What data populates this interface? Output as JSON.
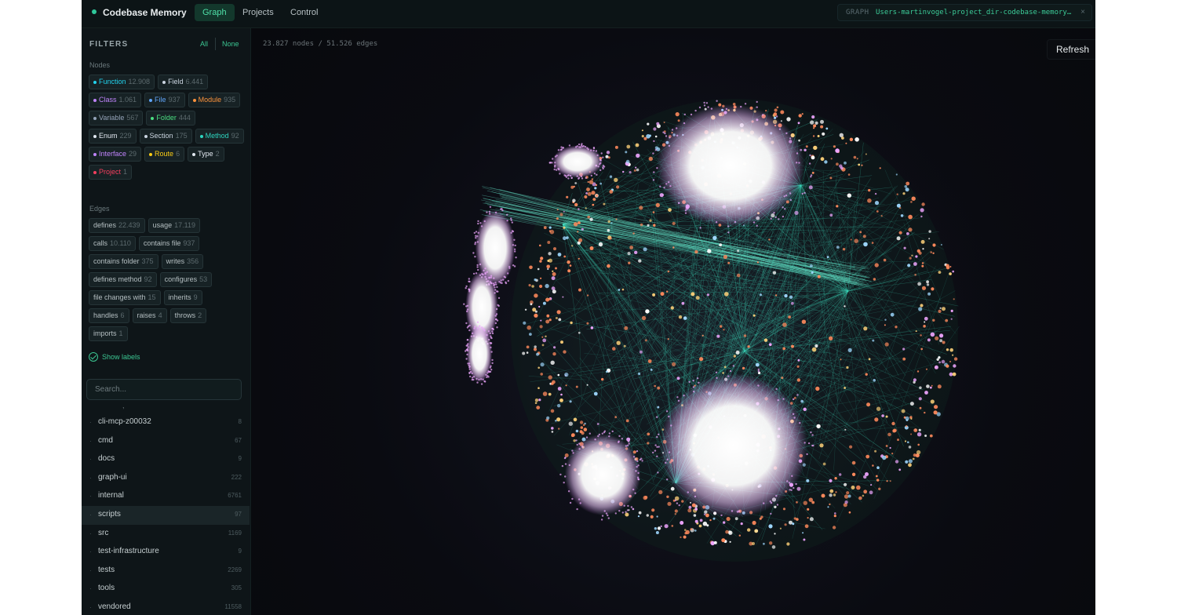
{
  "app": {
    "brand": "Codebase Memory",
    "tabs": [
      {
        "label": "Graph",
        "active": true
      },
      {
        "label": "Projects",
        "active": false
      },
      {
        "label": "Control",
        "active": false
      }
    ],
    "graph_pill": {
      "label": "GRAPH",
      "value": "Users-martinvogel-project_dir-codebase-memory-mcp",
      "close": "×"
    }
  },
  "filters": {
    "title": "FILTERS",
    "all": "All",
    "none": "None",
    "nodes_label": "Nodes",
    "edges_label": "Edges",
    "nodes": [
      {
        "name": "Function",
        "count": "12.908",
        "color": "#22d3ee"
      },
      {
        "name": "Field",
        "count": "6.441",
        "color": "#cbd5e1"
      },
      {
        "name": "Class",
        "count": "1.061",
        "color": "#c084fc"
      },
      {
        "name": "File",
        "count": "937",
        "color": "#60a5fa"
      },
      {
        "name": "Module",
        "count": "935",
        "color": "#fb923c"
      },
      {
        "name": "Variable",
        "count": "567",
        "color": "#94a3b8"
      },
      {
        "name": "Folder",
        "count": "444",
        "color": "#4ade80"
      },
      {
        "name": "Enum",
        "count": "229",
        "color": "#e2e8f0"
      },
      {
        "name": "Section",
        "count": "175",
        "color": "#cbd5e1"
      },
      {
        "name": "Method",
        "count": "92",
        "color": "#2dd4bf"
      },
      {
        "name": "Interface",
        "count": "29",
        "color": "#c084fc"
      },
      {
        "name": "Route",
        "count": "6",
        "color": "#facc15"
      },
      {
        "name": "Type",
        "count": "2",
        "color": "#e2e8f0"
      },
      {
        "name": "Project",
        "count": "1",
        "color": "#f43f5e"
      }
    ],
    "edges": [
      {
        "name": "defines",
        "count": "22.439"
      },
      {
        "name": "usage",
        "count": "17.119"
      },
      {
        "name": "calls",
        "count": "10.110"
      },
      {
        "name": "contains file",
        "count": "937"
      },
      {
        "name": "contains folder",
        "count": "375"
      },
      {
        "name": "writes",
        "count": "356"
      },
      {
        "name": "defines method",
        "count": "92"
      },
      {
        "name": "configures",
        "count": "53"
      },
      {
        "name": "file changes with",
        "count": "15"
      },
      {
        "name": "inherits",
        "count": "9"
      },
      {
        "name": "handles",
        "count": "6"
      },
      {
        "name": "raises",
        "count": "4"
      },
      {
        "name": "throws",
        "count": "2"
      },
      {
        "name": "imports",
        "count": "1"
      }
    ],
    "show_labels": "Show labels"
  },
  "search": {
    "placeholder": "Search..."
  },
  "tree": {
    "root_marker": ",",
    "items": [
      {
        "name": "cli-mcp-z00032",
        "count": "8",
        "selected": false
      },
      {
        "name": "cmd",
        "count": "67",
        "selected": false
      },
      {
        "name": "docs",
        "count": "9",
        "selected": false
      },
      {
        "name": "graph-ui",
        "count": "222",
        "selected": false
      },
      {
        "name": "internal",
        "count": "6761",
        "selected": false
      },
      {
        "name": "scripts",
        "count": "97",
        "selected": true
      },
      {
        "name": "src",
        "count": "1169",
        "selected": false
      },
      {
        "name": "test-infrastructure",
        "count": "9",
        "selected": false
      },
      {
        "name": "tests",
        "count": "2269",
        "selected": false
      },
      {
        "name": "tools",
        "count": "305",
        "selected": false
      },
      {
        "name": "vendored",
        "count": "11558",
        "selected": false
      }
    ]
  },
  "graph": {
    "stats": "23.827 nodes / 51.526 edges",
    "refresh": "Refresh",
    "colors": {
      "edge": "#3ee0c0",
      "node_orange": "#ff8a5c",
      "node_white": "#ffffff",
      "node_pink": "#f0a6ff",
      "node_blue": "#9fd8ff",
      "node_yellow": "#ffd27a",
      "accent": "#3bc692"
    }
  }
}
